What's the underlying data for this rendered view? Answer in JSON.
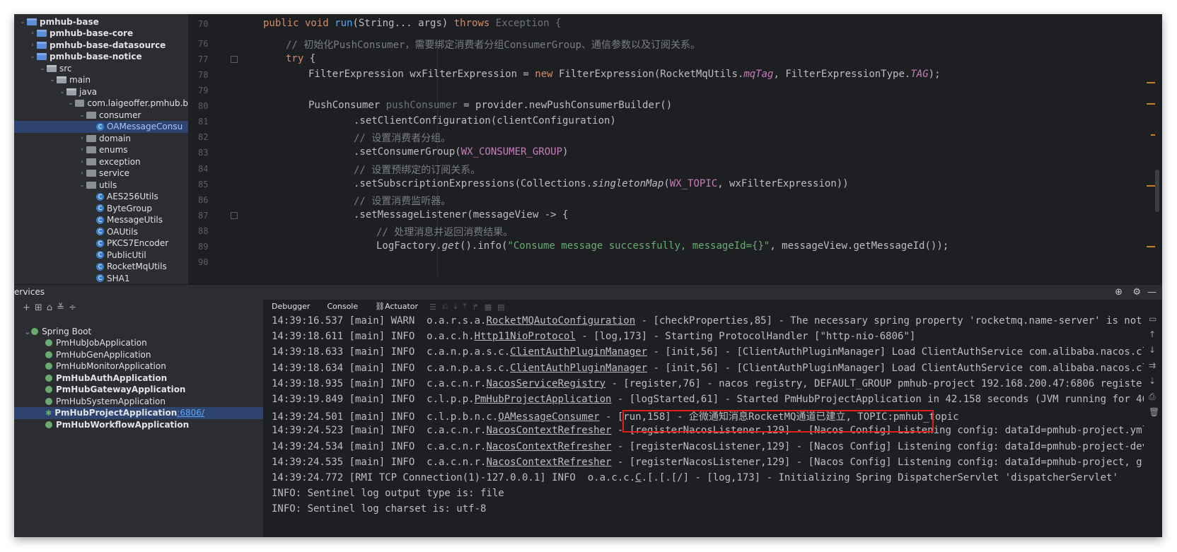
{
  "project_tree": {
    "items": [
      {
        "label": "pmhub-base",
        "icon": "module-icon",
        "level": 0,
        "expanded": true,
        "bold": true
      },
      {
        "label": "pmhub-base-core",
        "icon": "module-icon",
        "level": 1,
        "expanded": false,
        "bold": true
      },
      {
        "label": "pmhub-base-datasource",
        "icon": "module-icon",
        "level": 1,
        "expanded": false,
        "bold": true
      },
      {
        "label": "pmhub-base-notice",
        "icon": "module-icon",
        "level": 1,
        "expanded": true,
        "bold": true
      },
      {
        "label": "src",
        "icon": "folder-icon",
        "level": 2,
        "expanded": true
      },
      {
        "label": "main",
        "icon": "folder-icon",
        "level": 3,
        "expanded": true
      },
      {
        "label": "java",
        "icon": "folder-icon",
        "level": 4,
        "expanded": true
      },
      {
        "label": "com.laigeoffer.pmhub.b",
        "icon": "package-icon",
        "level": 5,
        "expanded": true
      },
      {
        "label": "consumer",
        "icon": "package-icon",
        "level": 6,
        "expanded": true
      },
      {
        "label": "OAMessageConsu",
        "icon": "class-icon",
        "level": 7,
        "selected": true
      },
      {
        "label": "domain",
        "icon": "package-icon",
        "level": 6,
        "expanded": false
      },
      {
        "label": "enums",
        "icon": "package-icon",
        "level": 6,
        "expanded": false
      },
      {
        "label": "exception",
        "icon": "package-icon",
        "level": 6,
        "expanded": false
      },
      {
        "label": "service",
        "icon": "package-icon",
        "level": 6,
        "expanded": false
      },
      {
        "label": "utils",
        "icon": "package-icon",
        "level": 6,
        "expanded": true
      },
      {
        "label": "AES256Utils",
        "icon": "class-icon",
        "level": 7
      },
      {
        "label": "ByteGroup",
        "icon": "class-icon",
        "level": 7
      },
      {
        "label": "MessageUtils",
        "icon": "class-icon",
        "level": 7
      },
      {
        "label": "OAUtils",
        "icon": "class-icon",
        "level": 7
      },
      {
        "label": "PKCS7Encoder",
        "icon": "class-icon",
        "level": 7
      },
      {
        "label": "PublicUtil",
        "icon": "class-icon",
        "level": 7
      },
      {
        "label": "RocketMqUtils",
        "icon": "class-icon",
        "level": 7
      },
      {
        "label": "SHA1",
        "icon": "class-icon",
        "level": 7
      }
    ]
  },
  "editor": {
    "line_numbers": [
      "70",
      "76",
      "77",
      "78",
      "79",
      "80",
      "81",
      "82",
      "83",
      "84",
      "85",
      "86",
      "87",
      "88",
      "89",
      "90"
    ],
    "code": {
      "l70": {
        "t1": "public void ",
        "t2": "run",
        "t3": "(String... args) ",
        "t4": "throws ",
        "t5": "Exception {"
      },
      "l76": "// 初始化PushConsumer，需要绑定消费者分组ConsumerGroup、通信参数以及订阅关系。",
      "l77": {
        "kw": "try",
        "rest": " {"
      },
      "l78": {
        "a": "FilterExpression wxFilterExpression = ",
        "b": "new ",
        "c": "FilterExpression(RocketMqUtils.",
        "d": "mqTag",
        "e": ", FilterExpressionType.",
        "f": "TAG",
        "g": ");"
      },
      "l80": {
        "a": "PushConsumer ",
        "b": "pushConsumer",
        "c": " = provider.newPushConsumerBuilder()"
      },
      "l81": ".setClientConfiguration(clientConfiguration)",
      "l82": "// 设置消费者分组。",
      "l83": {
        "a": ".setConsumerGroup(",
        "b": "WX_CONSUMER_GROUP",
        "c": ")"
      },
      "l84": "// 设置预绑定的订阅关系。",
      "l85": {
        "a": ".setSubscriptionExpressions(Collections.",
        "b": "singletonMap",
        "c": "(",
        "d": "WX_TOPIC",
        "e": ", wxFilterExpression))"
      },
      "l86": "// 设置消费监听器。",
      "l87": ".setMessageListener(messageView -> {",
      "l88": "// 处理消息并返回消费结果。",
      "l89": {
        "a": "LogFactory.",
        "b": "get",
        "c": "().info(",
        "d": "\"Consume message successfully, messageId={}\"",
        "e": ", messageView.getMessageId());"
      }
    }
  },
  "services": {
    "title": "ervices",
    "tree": [
      {
        "label": "Spring Boot",
        "level": 0,
        "bold": false
      },
      {
        "label": "PmHubJobApplication",
        "level": 1
      },
      {
        "label": "PmHubGenApplication",
        "level": 1
      },
      {
        "label": "PmHubMonitorApplication",
        "level": 1
      },
      {
        "label": "PmHubAuthApplication",
        "level": 1,
        "bold": true
      },
      {
        "label": "PmHubGatewayApplication",
        "level": 1,
        "bold": true
      },
      {
        "label": "PmHubSystemApplication",
        "level": 1
      },
      {
        "label": "PmHubProjectApplication",
        "level": 1,
        "bold": true,
        "selected": true,
        "port": ":6806/"
      },
      {
        "label": "PmHubWorkflowApplication",
        "level": 1,
        "bold": true
      }
    ]
  },
  "console": {
    "tabs": [
      "Debugger",
      "Console",
      "Actuator"
    ],
    "lines": [
      {
        "pre": "14:39:16.537 [main] WARN  o.a.r.s.a.",
        "cls": "RocketMQAutoConfiguration",
        "post": " - [checkProperties,85] - The necessary spring property 'rocketmq.name-server' is not"
      },
      {
        "pre": "14:39:18.611 [main] INFO  o.a.c.h.",
        "cls": "Http11NioProtocol",
        "post": " - [log,173] - Starting ProtocolHandler [\"http-nio-6806\"]"
      },
      {
        "pre": "14:39:18.633 [main] INFO  c.a.n.p.a.s.c.",
        "cls": "ClientAuthPluginManager",
        "post": " - [init,56] - [ClientAuthPluginManager] Load ClientAuthService com.alibaba.nacos.cl"
      },
      {
        "pre": "14:39:18.634 [main] INFO  c.a.n.p.a.s.c.",
        "cls": "ClientAuthPluginManager",
        "post": " - [init,56] - [ClientAuthPluginManager] Load ClientAuthService com.alibaba.nacos.cl"
      },
      {
        "pre": "14:39:18.935 [main] INFO  c.a.c.n.r.",
        "cls": "NacosServiceRegistry",
        "post": " - [register,76] - nacos registry, DEFAULT_GROUP pmhub-project 192.168.200.47:6806 register"
      },
      {
        "pre": "14:39:19.849 [main] INFO  c.l.p.p.",
        "cls": "PmHubProjectApplication",
        "post": " - [logStarted,61] - Started PmHubProjectApplication in 42.158 seconds (JVM running for 46"
      },
      {
        "pre": "14:39:24.501 [main] INFO  c.l.p.b.n.c.",
        "cls": "OAMessageConsumer",
        "post": " - [run,158] - 企微通知消息RocketMQ通道已建立, TOPIC:pmhub_topic"
      },
      {
        "pre": "14:39:24.523 [main] INFO  c.a.c.n.r.",
        "cls": "NacosContextRefresher",
        "post": " - [registerNacosListener,129] - [Nacos Config] Listening config: dataId=pmhub-project.yml"
      },
      {
        "pre": "14:39:24.534 [main] INFO  c.a.c.n.r.",
        "cls": "NacosContextRefresher",
        "post": " - [registerNacosListener,129] - [Nacos Config] Listening config: dataId=pmhub-project-dev"
      },
      {
        "pre": "14:39:24.535 [main] INFO  c.a.c.n.r.",
        "cls": "NacosContextRefresher",
        "post": " - [registerNacosListener,129] - [Nacos Config] Listening config: dataId=pmhub-project, gr"
      },
      {
        "pre": "14:39:24.772 [RMI TCP Connection(1)-127.0.0.1] INFO  o.a.c.c.",
        "cls": "C",
        "post": ".[.[.[/] - [log,173] - Initializing Spring DispatcherServlet 'dispatcherServlet'"
      },
      {
        "pre": "INFO: Sentinel log output type is: file",
        "cls": "",
        "post": ""
      },
      {
        "pre": "INFO: Sentinel log charset is: utf-8",
        "cls": "",
        "post": ""
      }
    ]
  }
}
